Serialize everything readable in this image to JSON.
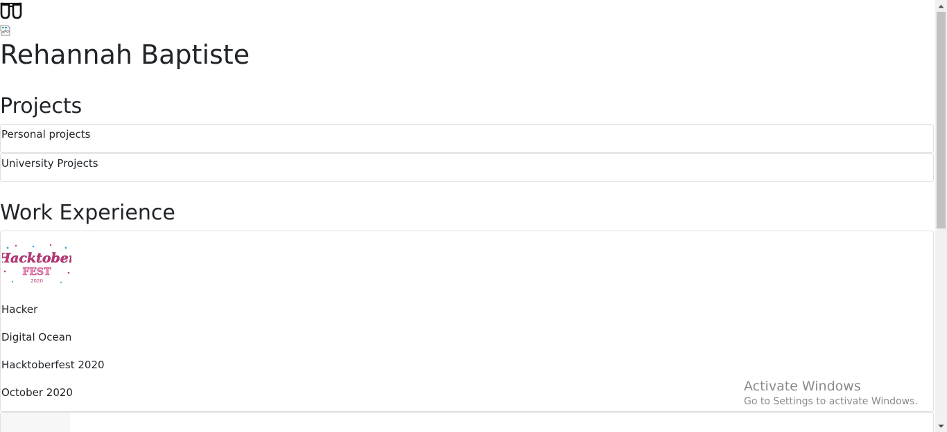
{
  "header": {
    "icon": "glasses-icon",
    "profile_image": "broken-image-icon",
    "name": "Rehannah Baptiste"
  },
  "projects": {
    "title": "Projects",
    "items": [
      {
        "label": "Personal projects"
      },
      {
        "label": "University Projects"
      }
    ]
  },
  "work": {
    "title": "Work Experience",
    "items": [
      {
        "logo": "hacktoberfest-2020-logo",
        "logo_text": "Hacktober FEST 2020",
        "role": "Hacker",
        "company": "Digital Ocean",
        "event": "Hacktoberfest 2020",
        "date": "October 2020"
      }
    ]
  },
  "watermark": {
    "title": "Activate Windows",
    "subtitle": "Go to Settings to activate Windows."
  },
  "colors": {
    "text": "#212529",
    "border": "#dfdfdf",
    "logo_pink": "#c2357a",
    "logo_blue": "#5aa8d8",
    "watermark": "#8a8a8a"
  }
}
